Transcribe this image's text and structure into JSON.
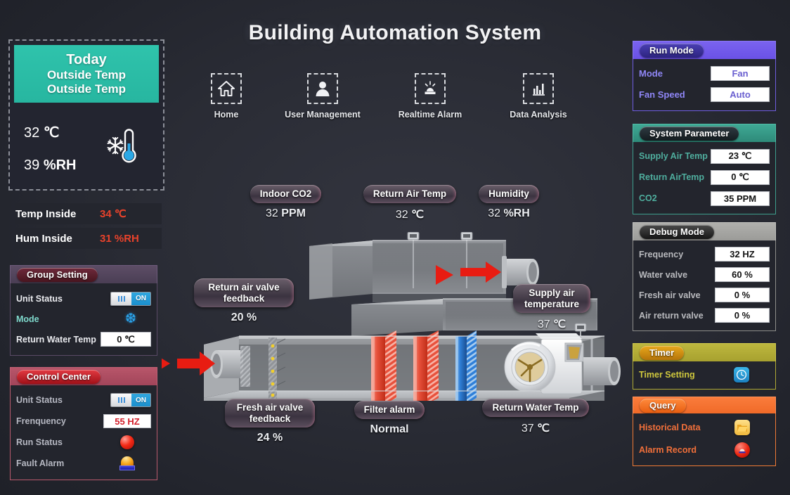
{
  "app": {
    "title": "Building Automation System"
  },
  "topnav": [
    {
      "label": "Home",
      "icon": "home-icon"
    },
    {
      "label": "User Management",
      "icon": "user-icon"
    },
    {
      "label": "Realtime Alarm",
      "icon": "alarm-beacon-icon"
    },
    {
      "label": "Data Analysis",
      "icon": "bar-chart-icon"
    }
  ],
  "today": {
    "line1": "Today",
    "line2": "Outside Temp",
    "line3": "Outside Temp",
    "temp_value": "32",
    "temp_unit": "℃",
    "hum_value": "39",
    "hum_unit": "%RH",
    "icon": "thermometer-snowflake-icon"
  },
  "inside": {
    "temp_label": "Temp Inside",
    "temp_value": "34 ℃",
    "hum_label": "Hum Inside",
    "hum_value": "31 %RH",
    "accent_color": "#e8422b"
  },
  "group_setting": {
    "title": "Group Setting",
    "rows": [
      {
        "label": "Unit Status",
        "control": "toggle",
        "state": "ON"
      },
      {
        "label": "Mode",
        "control": "snowflake-icon",
        "state": "Cooling"
      },
      {
        "label": "Return Water Temp",
        "control": "field",
        "value": "0 ℃"
      }
    ],
    "toggle_on_label": "ON"
  },
  "control_center": {
    "title": "Control Center",
    "rows": [
      {
        "label": "Unit Status",
        "control": "toggle",
        "state": "ON"
      },
      {
        "label": "Frenquency",
        "control": "field",
        "value": "55 HZ"
      },
      {
        "label": "Run Status",
        "control": "red-lamp-icon"
      },
      {
        "label": "Fault Alarm",
        "control": "beacon-icon"
      }
    ],
    "toggle_on_label": "ON"
  },
  "run_mode": {
    "title": "Run Mode",
    "rows": [
      {
        "label": "Mode",
        "value": "Fan"
      },
      {
        "label": "Fan Speed",
        "value": "Auto"
      }
    ]
  },
  "system_parameter": {
    "title": "System Parameter",
    "rows": [
      {
        "label": "Supply Air Temp",
        "value": "23 ℃"
      },
      {
        "label": "Return AirTemp",
        "value": "0 ℃"
      },
      {
        "label": "CO2",
        "value": "35 PPM"
      }
    ]
  },
  "debug_mode": {
    "title": "Debug Mode",
    "rows": [
      {
        "label": "Frequency",
        "value": "32 HZ"
      },
      {
        "label": "Water valve",
        "value": "60 %"
      },
      {
        "label": "Fresh air valve",
        "value": "0 %"
      },
      {
        "label": "Air return valve",
        "value": "0 %"
      }
    ]
  },
  "timer": {
    "title": "Timer",
    "rows": [
      {
        "label": "Timer Setting",
        "control": "clock-icon"
      }
    ]
  },
  "query": {
    "title": "Query",
    "rows": [
      {
        "label": "Historical Data",
        "control": "folder-icon"
      },
      {
        "label": "Alarm Record",
        "control": "alarm-icon"
      }
    ]
  },
  "diagram": {
    "tags": [
      {
        "id": "co2",
        "label": "Indoor CO2",
        "value_num": "32",
        "value_unit": "PPM"
      },
      {
        "id": "rat",
        "label": "Return Air Temp",
        "value_num": "32",
        "value_unit": "℃"
      },
      {
        "id": "hum",
        "label": "Humidity",
        "value_num": "32",
        "value_unit": "%RH"
      },
      {
        "id": "ravf",
        "label": "Return air valve feedback",
        "value_num": "20",
        "value_unit": "%"
      },
      {
        "id": "sat",
        "label": "Supply air temperature",
        "value_num": "37",
        "value_unit": "℃"
      },
      {
        "id": "favf",
        "label": "Fresh air valve feedback",
        "value_num": "24",
        "value_unit": "%"
      },
      {
        "id": "filter",
        "label": "Filter alarm",
        "value_num": "",
        "value_unit": "Normal"
      },
      {
        "id": "rwt",
        "label": "Return Water Temp",
        "value_num": "37",
        "value_unit": "℃"
      }
    ],
    "airflow_arrow_color": "#e81c12",
    "heating_coil_color": "#e8513c",
    "cooling_coil_color": "#2f7fd8"
  },
  "colors": {
    "background": "#23252c",
    "today_header": "#2fc3ac",
    "run_mode": "#7a63ef",
    "system_parameter": "#3fa995",
    "debug_mode": "#b0b0ad",
    "timer": "#bdb73e",
    "query": "#fa7c3c",
    "control_center": "#b8566a",
    "group_setting": "#5d4d66"
  }
}
